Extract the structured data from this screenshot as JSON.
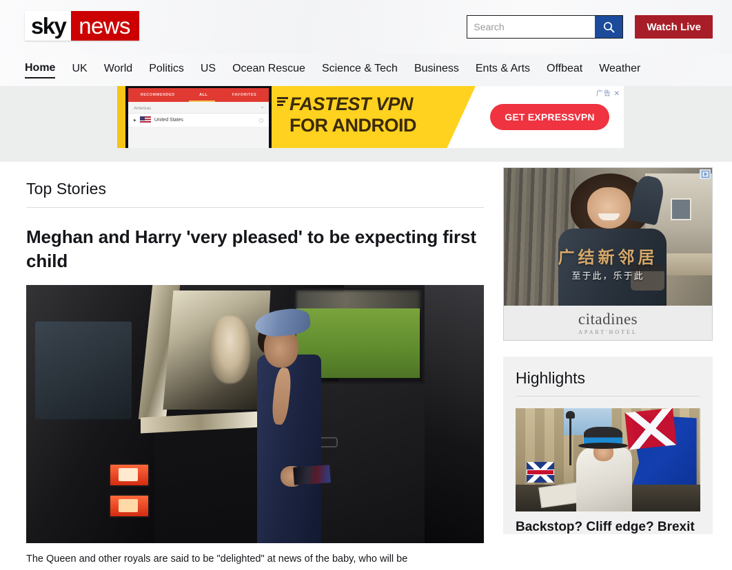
{
  "header": {
    "logo": {
      "part1": "sky",
      "part2": "news"
    },
    "search": {
      "placeholder": "Search",
      "value": "",
      "icon": "search-icon"
    },
    "watch_live_label": "Watch Live"
  },
  "nav": {
    "items": [
      {
        "label": "Home",
        "active": true
      },
      {
        "label": "UK",
        "active": false
      },
      {
        "label": "World",
        "active": false
      },
      {
        "label": "Politics",
        "active": false
      },
      {
        "label": "US",
        "active": false
      },
      {
        "label": "Ocean Rescue",
        "active": false
      },
      {
        "label": "Science & Tech",
        "active": false
      },
      {
        "label": "Business",
        "active": false
      },
      {
        "label": "Ents & Arts",
        "active": false
      },
      {
        "label": "Offbeat",
        "active": false
      },
      {
        "label": "Weather",
        "active": false
      }
    ]
  },
  "leaderboard_ad": {
    "phone": {
      "tabs": [
        "RECOMMENDED",
        "ALL",
        "FAVORITES"
      ],
      "selected_tab": "ALL",
      "section_label": "Americas",
      "row_label": "United States"
    },
    "headline_line1": "FASTEST VPN",
    "headline_line2": "FOR ANDROID",
    "cta_label": "GET EXPRESSVPN",
    "close_label": "广告 ✕"
  },
  "main": {
    "section_title": "Top Stories",
    "story": {
      "headline": "Meghan and Harry 'very pleased' to be expecting first child",
      "caption": "The Queen and other royals are said to be \"delighted\" at news of the baby, who will be"
    }
  },
  "sidebar": {
    "ad": {
      "headline_cn": "广结新邻居",
      "subhead_cn": "至于此，乐于此",
      "brand": "citadines",
      "brand_sub": "APART'HOTEL",
      "adchoices_icon": "adchoices-icon"
    },
    "highlights": {
      "title": "Highlights",
      "item_headline": "Backstop? Cliff edge? Brexit jargon"
    }
  },
  "colors": {
    "brand_red": "#cc0000",
    "watch_live_red": "#a81e28",
    "search_blue": "#1c4b9b",
    "ad_yellow": "#ffd21f",
    "ad_cta_red": "#ef3340",
    "text": "#14161a"
  }
}
